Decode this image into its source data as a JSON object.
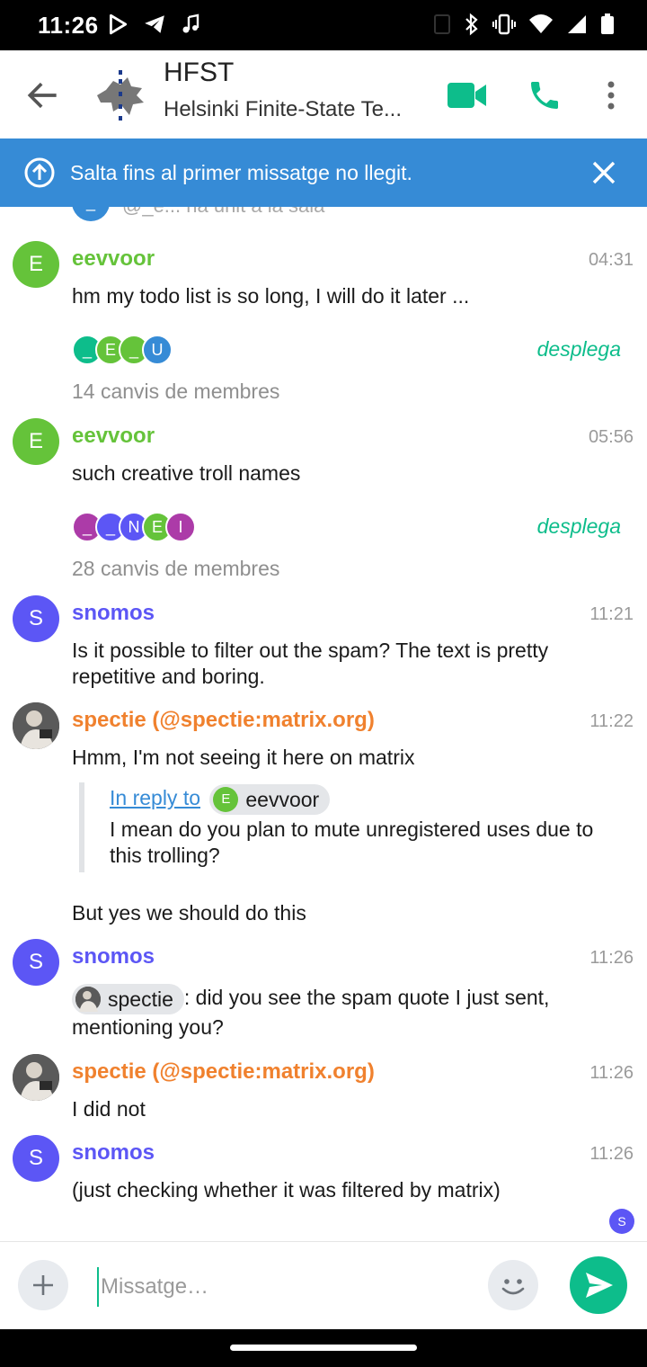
{
  "status_bar": {
    "time": "11:26"
  },
  "header": {
    "room_name": "HFST",
    "room_topic": "Helsinki Finite-State Te..."
  },
  "banner": {
    "text": "Salta fins al primer missatge no llegit."
  },
  "timeline": {
    "clipped_top_text": "@_e... ha unit a la sala",
    "messages": [
      {
        "avatar_letter": "E",
        "sender": "eevvoor",
        "time": "04:31",
        "text": "hm my todo list is so long, I will do it later ..."
      },
      {
        "avatar_letter": "E",
        "sender": "eevvoor",
        "time": "05:56",
        "text": "such creative troll names"
      },
      {
        "avatar_letter": "S",
        "sender": "snomos",
        "time": "11:21",
        "text": "Is it possible to filter out the spam? The text is pretty repetitive and boring."
      },
      {
        "sender": "spectie (@spectie:matrix.org)",
        "time": "11:22",
        "text": "Hmm, I'm not seeing it here on matrix"
      },
      {
        "avatar_letter": "S",
        "sender": "snomos",
        "time": "11:26",
        "text": ": did you see the spam quote I just sent, mentioning you?"
      },
      {
        "sender": "spectie (@spectie:matrix.org)",
        "time": "11:26",
        "text": "I did not"
      },
      {
        "avatar_letter": "S",
        "sender": "snomos",
        "time": "11:26",
        "text": "(just checking whether it was filtered by matrix)"
      }
    ],
    "member_groups": [
      {
        "letters": [
          "_",
          "E",
          "_",
          "U"
        ],
        "summary": "14 canvis de membres",
        "expand": "desplega"
      },
      {
        "letters": [
          "_",
          "_",
          "N",
          "E",
          "I"
        ],
        "summary": "28 canvis de membres",
        "expand": "desplega"
      }
    ],
    "quote": {
      "in_reply_to": "In reply to",
      "pill_letter": "E",
      "pill_name": "eevvoor",
      "text": "I mean do you plan to mute unregistered uses due to this trolling?"
    },
    "followup_text": "But yes we should do this",
    "mention_pill": "spectie",
    "read_marker_letter": "S"
  },
  "composer": {
    "placeholder": "Missatge…"
  },
  "colors": {
    "accent": "#0dbd8b",
    "banner": "#368bd6",
    "eevvoor": "#65c33a",
    "snomos": "#5c56f5",
    "spectie": "#f0812e"
  }
}
